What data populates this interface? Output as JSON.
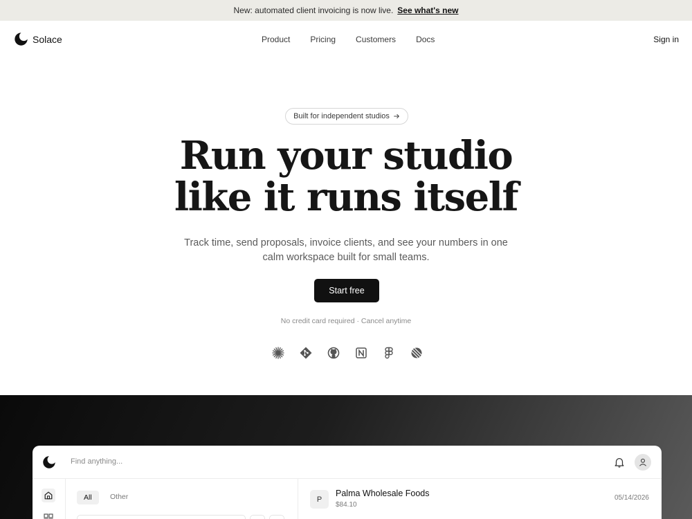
{
  "banner": {
    "text": "New: automated client invoicing is now live.",
    "link": "See what's new"
  },
  "nav": {
    "brand": "Solace",
    "links": [
      "Product",
      "Pricing",
      "Customers",
      "Docs"
    ],
    "sign_in": "Sign in"
  },
  "hero": {
    "badge": "Built for independent studios",
    "badge_icon": "arrow-right-icon",
    "headline_line1": "Run your studio",
    "headline_line2": "like it runs itself",
    "subtitle": "Track time, send proposals, invoice clients, and see your numbers in one calm workspace built for small teams.",
    "cta": "Start free",
    "fine_print": "No credit card required · Cancel anytime"
  },
  "integrations": [
    "sunburst-icon",
    "git-icon",
    "github-icon",
    "notion-icon",
    "figma-icon",
    "linear-icon"
  ],
  "app_preview": {
    "search_placeholder": "Find anything...",
    "tabs": [
      "All",
      "Other"
    ],
    "selected_item": {
      "initial": "P",
      "name": "Palma Wholesale Foods",
      "amount": "$84.10",
      "date": "05/14/2026"
    }
  },
  "colors": {
    "banner_bg": "#ecebe6",
    "cta_bg": "#111111",
    "showcase_gradient": [
      "#0a0a0a",
      "#5a5a5a"
    ]
  }
}
